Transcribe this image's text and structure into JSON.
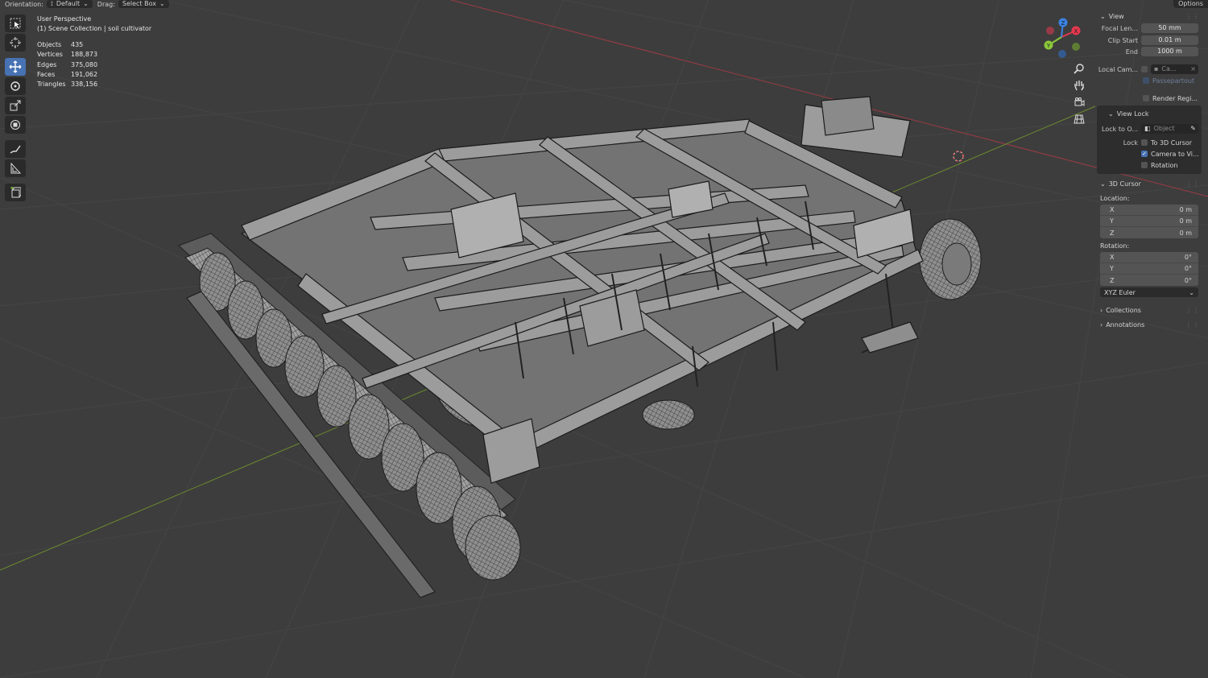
{
  "header": {
    "orientation_label": "Orientation:",
    "orientation_value": "Default",
    "drag_label": "Drag:",
    "drag_value": "Select Box",
    "options_label": "Options"
  },
  "overlay": {
    "perspective": "User Perspective",
    "collection": "(1) Scene Collection | soil cultivator",
    "stats": [
      {
        "label": "Objects",
        "value": "435"
      },
      {
        "label": "Vertices",
        "value": "188,873"
      },
      {
        "label": "Edges",
        "value": "375,080"
      },
      {
        "label": "Faces",
        "value": "191,062"
      },
      {
        "label": "Triangles",
        "value": "338,156"
      }
    ]
  },
  "toolbar": {
    "tools": [
      "select-box-icon",
      "cursor-icon",
      "move-icon",
      "rotate-icon",
      "scale-icon",
      "transform-icon",
      "annotate-icon",
      "measure-icon",
      "add-cube-icon"
    ],
    "active_index": 2
  },
  "gizmo": {
    "x_label": "X",
    "y_label": "Y",
    "z_label": "Z",
    "x_color": "#e5384f",
    "y_color": "#8bc73a",
    "z_color": "#3b83e4"
  },
  "npanel": {
    "view": {
      "title": "View",
      "focal_label": "Focal Len...",
      "focal_value": "50 mm",
      "clip_start_label": "Clip Start",
      "clip_start_value": "0.01 m",
      "end_label": "End",
      "end_value": "1000 m",
      "local_cam_label": "Local Cam...",
      "local_cam_value": "Ca...",
      "passepartout_label": "Passepartout",
      "render_region_label": "Render Regi..."
    },
    "view_lock": {
      "title": "View Lock",
      "lock_obj_label": "Lock to O...",
      "lock_obj_placeholder": "Object",
      "lock_label": "Lock",
      "to_cursor_label": "To 3D Cursor",
      "camera_label": "Camera to Vi...",
      "camera_checked": true,
      "rotation_label": "Rotation"
    },
    "cursor": {
      "title": "3D Cursor",
      "location_label": "Location:",
      "location": [
        {
          "axis": "X",
          "value": "0 m"
        },
        {
          "axis": "Y",
          "value": "0 m"
        },
        {
          "axis": "Z",
          "value": "0 m"
        }
      ],
      "rotation_label": "Rotation:",
      "rotation": [
        {
          "axis": "X",
          "value": "0°"
        },
        {
          "axis": "Y",
          "value": "0°"
        },
        {
          "axis": "Z",
          "value": "0°"
        }
      ],
      "rotation_mode": "XYZ Euler"
    },
    "collections_title": "Collections",
    "annotations_title": "Annotations"
  },
  "colors": {
    "viewport_bg": "#3d3d3d",
    "panel_bg": "#2d2d2d",
    "accent": "#4772b3",
    "axis_red": "#9c3b45",
    "axis_green": "#6b8a2e",
    "mesh_fill": "#9a9a9a",
    "mesh_wire": "#262626"
  }
}
